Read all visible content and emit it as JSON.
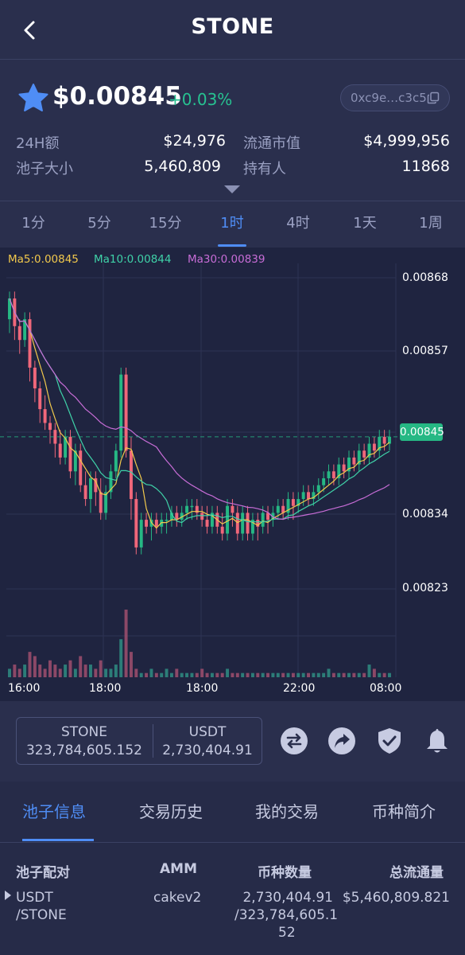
{
  "header": {
    "title": "STONE"
  },
  "token": {
    "price": "$0.00845",
    "change": "+0.03%",
    "address": "0xc9e…c3c5"
  },
  "stats": [
    {
      "label": "24H额",
      "value": "$24,976"
    },
    {
      "label": "流通市值",
      "value": "$4,999,956"
    },
    {
      "label": "池子大小",
      "value": "5,460,809"
    },
    {
      "label": "持有人",
      "value": "11868"
    }
  ],
  "timeframes": [
    "1分",
    "5分",
    "15分",
    "1时",
    "4时",
    "1天",
    "1周"
  ],
  "active_timeframe": "1时",
  "chart_data": {
    "type": "candlestick",
    "moving_averages": [
      {
        "name": "Ma5",
        "value": "0.00845",
        "label": "Ma5:0.00845",
        "color": "#f2c94c"
      },
      {
        "name": "Ma10",
        "value": "0.00844",
        "label": "Ma10:0.00844",
        "color": "#3fd2a8"
      },
      {
        "name": "Ma30",
        "value": "0.00839",
        "label": "Ma30:0.00839",
        "color": "#c86dd7"
      }
    ],
    "y_ticks": [
      "0.00868",
      "0.00857",
      "0.00834",
      "0.00823"
    ],
    "current_price": "0.00845",
    "x_ticks": [
      "16:00",
      "18:00",
      "18:00",
      "22:00",
      "08:00"
    ],
    "up_color": "#26b884",
    "down_color": "#f0677a",
    "candles": [
      {
        "o": 0.00862,
        "c": 0.00865,
        "h": 0.00866,
        "l": 0.0086
      },
      {
        "o": 0.00865,
        "c": 0.00861,
        "h": 0.00866,
        "l": 0.00859
      },
      {
        "o": 0.00861,
        "c": 0.00859,
        "h": 0.00862,
        "l": 0.00857
      },
      {
        "o": 0.00859,
        "c": 0.00862,
        "h": 0.00863,
        "l": 0.00858
      },
      {
        "o": 0.00862,
        "c": 0.00855,
        "h": 0.00863,
        "l": 0.00853
      },
      {
        "o": 0.00855,
        "c": 0.00852,
        "h": 0.00856,
        "l": 0.0085
      },
      {
        "o": 0.00852,
        "c": 0.00849,
        "h": 0.00853,
        "l": 0.00847
      },
      {
        "o": 0.00849,
        "c": 0.00847,
        "h": 0.00851,
        "l": 0.00846
      },
      {
        "o": 0.00847,
        "c": 0.00846,
        "h": 0.00848,
        "l": 0.00844
      },
      {
        "o": 0.00846,
        "c": 0.00844,
        "h": 0.00847,
        "l": 0.00842
      },
      {
        "o": 0.00844,
        "c": 0.00842,
        "h": 0.00846,
        "l": 0.00841
      },
      {
        "o": 0.00842,
        "c": 0.00845,
        "h": 0.00846,
        "l": 0.00841
      },
      {
        "o": 0.00845,
        "c": 0.0084,
        "h": 0.00846,
        "l": 0.00839
      },
      {
        "o": 0.0084,
        "c": 0.00843,
        "h": 0.00844,
        "l": 0.00838
      },
      {
        "o": 0.00843,
        "c": 0.00838,
        "h": 0.00844,
        "l": 0.00837
      },
      {
        "o": 0.00838,
        "c": 0.00836,
        "h": 0.0084,
        "l": 0.00835
      },
      {
        "o": 0.00836,
        "c": 0.00839,
        "h": 0.0084,
        "l": 0.00834
      },
      {
        "o": 0.00839,
        "c": 0.00837,
        "h": 0.0084,
        "l": 0.00835
      },
      {
        "o": 0.00837,
        "c": 0.00834,
        "h": 0.00839,
        "l": 0.00833
      },
      {
        "o": 0.00834,
        "c": 0.00837,
        "h": 0.00838,
        "l": 0.00833
      },
      {
        "o": 0.00837,
        "c": 0.0084,
        "h": 0.00841,
        "l": 0.00836
      },
      {
        "o": 0.0084,
        "c": 0.00843,
        "h": 0.00844,
        "l": 0.00839
      },
      {
        "o": 0.00843,
        "c": 0.00854,
        "h": 0.00855,
        "l": 0.00842
      },
      {
        "o": 0.00854,
        "c": 0.00843,
        "h": 0.00855,
        "l": 0.00842
      },
      {
        "o": 0.00843,
        "c": 0.00836,
        "h": 0.00845,
        "l": 0.00833
      },
      {
        "o": 0.00836,
        "c": 0.00829,
        "h": 0.00837,
        "l": 0.00828
      },
      {
        "o": 0.00829,
        "c": 0.00833,
        "h": 0.00834,
        "l": 0.00828
      },
      {
        "o": 0.00833,
        "c": 0.00832,
        "h": 0.00834,
        "l": 0.00831
      },
      {
        "o": 0.00832,
        "c": 0.00833,
        "h": 0.00834,
        "l": 0.0083
      },
      {
        "o": 0.00833,
        "c": 0.00832,
        "h": 0.00834,
        "l": 0.00831
      },
      {
        "o": 0.00832,
        "c": 0.00833,
        "h": 0.00834,
        "l": 0.00831
      },
      {
        "o": 0.00833,
        "c": 0.00833,
        "h": 0.00834,
        "l": 0.00831
      },
      {
        "o": 0.00833,
        "c": 0.00834,
        "h": 0.00835,
        "l": 0.00832
      },
      {
        "o": 0.00834,
        "c": 0.00833,
        "h": 0.00835,
        "l": 0.00832
      },
      {
        "o": 0.00833,
        "c": 0.00834,
        "h": 0.00835,
        "l": 0.00832
      },
      {
        "o": 0.00834,
        "c": 0.00835,
        "h": 0.00836,
        "l": 0.00833
      },
      {
        "o": 0.00835,
        "c": 0.00835,
        "h": 0.00836,
        "l": 0.00833
      },
      {
        "o": 0.00835,
        "c": 0.00834,
        "h": 0.00836,
        "l": 0.00833
      },
      {
        "o": 0.00834,
        "c": 0.00833,
        "h": 0.00835,
        "l": 0.00832
      },
      {
        "o": 0.00833,
        "c": 0.00832,
        "h": 0.00835,
        "l": 0.00831
      },
      {
        "o": 0.00832,
        "c": 0.00834,
        "h": 0.00835,
        "l": 0.00831
      },
      {
        "o": 0.00834,
        "c": 0.00832,
        "h": 0.00835,
        "l": 0.00831
      },
      {
        "o": 0.00832,
        "c": 0.00831,
        "h": 0.00834,
        "l": 0.0083
      },
      {
        "o": 0.00831,
        "c": 0.00835,
        "h": 0.00836,
        "l": 0.0083
      },
      {
        "o": 0.00835,
        "c": 0.00834,
        "h": 0.00836,
        "l": 0.00832
      },
      {
        "o": 0.00834,
        "c": 0.00831,
        "h": 0.00835,
        "l": 0.0083
      },
      {
        "o": 0.00831,
        "c": 0.00834,
        "h": 0.00835,
        "l": 0.0083
      },
      {
        "o": 0.00834,
        "c": 0.00831,
        "h": 0.00835,
        "l": 0.0083
      },
      {
        "o": 0.00831,
        "c": 0.00833,
        "h": 0.00834,
        "l": 0.0083
      },
      {
        "o": 0.00833,
        "c": 0.00832,
        "h": 0.00834,
        "l": 0.0083
      },
      {
        "o": 0.00832,
        "c": 0.00834,
        "h": 0.00835,
        "l": 0.00831
      },
      {
        "o": 0.00834,
        "c": 0.00833,
        "h": 0.00835,
        "l": 0.00831
      },
      {
        "o": 0.00833,
        "c": 0.00834,
        "h": 0.00835,
        "l": 0.00832
      },
      {
        "o": 0.00834,
        "c": 0.00835,
        "h": 0.00836,
        "l": 0.00833
      },
      {
        "o": 0.00835,
        "c": 0.00834,
        "h": 0.00836,
        "l": 0.00833
      },
      {
        "o": 0.00834,
        "c": 0.00836,
        "h": 0.00837,
        "l": 0.00833
      },
      {
        "o": 0.00836,
        "c": 0.00835,
        "h": 0.00837,
        "l": 0.00833
      },
      {
        "o": 0.00835,
        "c": 0.00836,
        "h": 0.00837,
        "l": 0.00834
      },
      {
        "o": 0.00836,
        "c": 0.00837,
        "h": 0.00838,
        "l": 0.00835
      },
      {
        "o": 0.00837,
        "c": 0.00836,
        "h": 0.00838,
        "l": 0.00835
      },
      {
        "o": 0.00836,
        "c": 0.00837,
        "h": 0.00838,
        "l": 0.00835
      },
      {
        "o": 0.00837,
        "c": 0.00838,
        "h": 0.00839,
        "l": 0.00836
      },
      {
        "o": 0.00838,
        "c": 0.00839,
        "h": 0.0084,
        "l": 0.00837
      },
      {
        "o": 0.00839,
        "c": 0.0084,
        "h": 0.00841,
        "l": 0.00838
      },
      {
        "o": 0.0084,
        "c": 0.00839,
        "h": 0.00841,
        "l": 0.00838
      },
      {
        "o": 0.00839,
        "c": 0.00841,
        "h": 0.00842,
        "l": 0.00838
      },
      {
        "o": 0.00841,
        "c": 0.0084,
        "h": 0.00842,
        "l": 0.00839
      },
      {
        "o": 0.0084,
        "c": 0.00842,
        "h": 0.00843,
        "l": 0.00839
      },
      {
        "o": 0.00842,
        "c": 0.00841,
        "h": 0.00843,
        "l": 0.0084
      },
      {
        "o": 0.00841,
        "c": 0.00843,
        "h": 0.00844,
        "l": 0.0084
      },
      {
        "o": 0.00843,
        "c": 0.00842,
        "h": 0.00844,
        "l": 0.00841
      },
      {
        "o": 0.00842,
        "c": 0.00844,
        "h": 0.00845,
        "l": 0.00841
      },
      {
        "o": 0.00844,
        "c": 0.00843,
        "h": 0.00845,
        "l": 0.00842
      },
      {
        "o": 0.00843,
        "c": 0.00845,
        "h": 0.00846,
        "l": 0.00842
      },
      {
        "o": 0.00845,
        "c": 0.00844,
        "h": 0.00846,
        "l": 0.00843
      },
      {
        "o": 0.00844,
        "c": 0.00845,
        "h": 0.00846,
        "l": 0.00843
      }
    ],
    "volumes": [
      2,
      3,
      2,
      3,
      6,
      5,
      3,
      2,
      4,
      3,
      2,
      3,
      4,
      2,
      5,
      3,
      3,
      2,
      4,
      2,
      2,
      3,
      9,
      16,
      6,
      2,
      1,
      1,
      2,
      1,
      1,
      2,
      1,
      2,
      1,
      1,
      1,
      1,
      2,
      1,
      1,
      1,
      1,
      2,
      1,
      1,
      1,
      1,
      1,
      1,
      1,
      1,
      1,
      1,
      1,
      1,
      1,
      1,
      1,
      1,
      1,
      1,
      1,
      2,
      1,
      1,
      1,
      1,
      1,
      1,
      1,
      3,
      2,
      1,
      1,
      1
    ]
  },
  "pool_box": {
    "left_symbol": "STONE",
    "left_amount": "323,784,605.152",
    "right_symbol": "USDT",
    "right_amount": "2,730,404.91"
  },
  "icons": [
    "swap-icon",
    "share-icon",
    "shield-check-icon",
    "bell-icon"
  ],
  "bottom_tabs": [
    "池子信息",
    "交易历史",
    "我的交易",
    "币种简介"
  ],
  "active_bottom_tab": "池子信息",
  "table": {
    "headers": [
      "池子配对",
      "AMM",
      "币种数量",
      "总流通量"
    ],
    "row": {
      "pair_line1": "USDT",
      "pair_line2": "/STONE",
      "amm": "cakev2",
      "qty_line1": "2,730,404.91",
      "qty_line2": "/323,784,605.1",
      "qty_line3": "52",
      "total": "$5,460,809.821"
    }
  }
}
